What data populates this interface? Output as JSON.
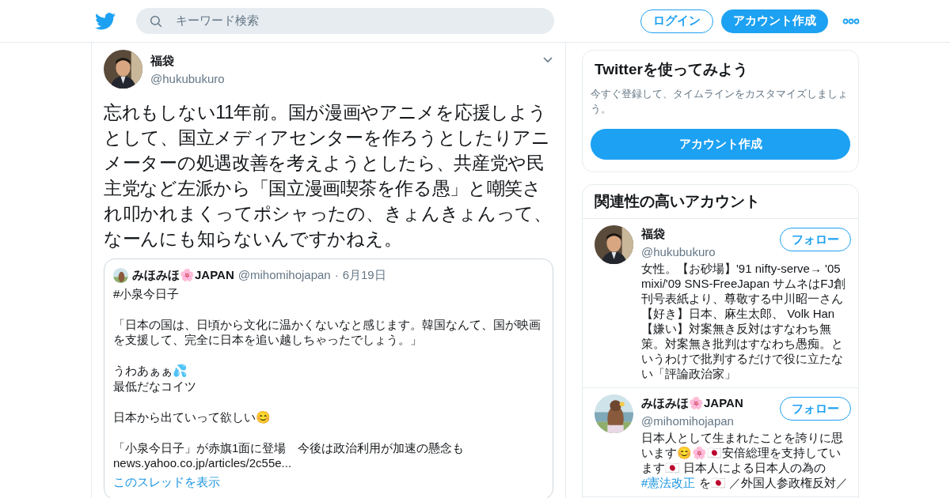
{
  "header": {
    "search": {
      "placeholder": "キーワード検索"
    },
    "login": "ログイン",
    "signup": "アカウント作成"
  },
  "tweet": {
    "name": "福袋",
    "handle": "@hukubukuro",
    "text": "忘れもしない11年前。国が漫画やアニメを応援しようとして、国立メディアセンターを作ろうとしたりアニメーターの処遇改善を考えようとしたら、共産党や民主党など左派から「国立漫画喫茶を作る愚」と嘲笑され叩かれまくってポシャったの、きょんきょんって、なーんにも知らないんですかねえ。",
    "quote": {
      "name": "みほみほ🌸JAPAN",
      "handle": "@mihomihojapan",
      "separator": "·",
      "date": "6月19日",
      "paragraphs": [
        [
          "#小泉今日子"
        ],
        [
          "「日本の国は、日頃から文化に温かくないなと感じます。韓国なんて、国が映画を支援して、完全に日本を追い越しちゃったでしょう。」"
        ],
        [
          "うわあぁぁ💦",
          "最低だなコイツ"
        ],
        [
          "日本から出ていって欲しい😊"
        ],
        [
          "「小泉今日子」が赤旗1面に登場　今後は政治利用が加速の懸念も",
          "news.yahoo.co.jp/articles/2c55e..."
        ]
      ],
      "thread_link": "このスレッドを表示"
    }
  },
  "signup_card": {
    "title": "Twitterを使ってみよう",
    "subtitle": "今すぐ登録して、タイムラインをカスタマイズしましょう。",
    "button": "アカウント作成"
  },
  "related": {
    "title": "関連性の高いアカウント",
    "accounts": [
      {
        "name": "福袋",
        "handle": "@hukubukuro",
        "follow": "フォロー",
        "bio": [
          {
            "kind": "text",
            "text": "女性。【お砂場】'91 nifty-serve→ '05 mixi/'09 SNS-FreeJapan サムネはFJ創刊号表紙より、尊敬する中川昭一さん【好き】日本、麻生太郎、 Volk Han 【嫌い】対案無き反対はすなわち無策。対案無き批判はすなわち愚痴。というわけで批判するだけで役に立たない「評論政治家」"
          }
        ]
      },
      {
        "name": "みほみほ🌸JAPAN",
        "handle": "@mihomihojapan",
        "follow": "フォロー",
        "bio": [
          {
            "kind": "text",
            "text": "日本人として生まれたことを誇りに思います😊🌸🇯🇵安倍総理を支持しています🇯🇵 日本人による日本人の為の "
          },
          {
            "kind": "link",
            "text": "#憲法改正"
          },
          {
            "kind": "text",
            "text": " を🇯🇵 ／外国人参政権反対／"
          }
        ]
      }
    ]
  }
}
